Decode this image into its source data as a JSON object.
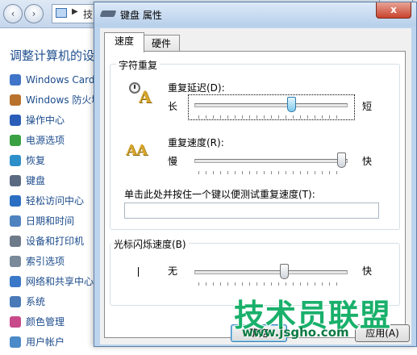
{
  "background": {
    "address_text": "技",
    "heading": "调整计算机的设",
    "items": [
      {
        "label": "Windows Card",
        "icon": "cardspace-icon",
        "color": "#3f74c9"
      },
      {
        "label": "Windows 防火墙",
        "icon": "firewall-icon",
        "color": "#b8722c"
      },
      {
        "label": "操作中心",
        "icon": "flag-icon",
        "color": "#2a5db8"
      },
      {
        "label": "电源选项",
        "icon": "power-icon",
        "color": "#3aa043"
      },
      {
        "label": "恢复",
        "icon": "recovery-icon",
        "color": "#2c8fc9"
      },
      {
        "label": "键盘",
        "icon": "keyboard-icon",
        "color": "#5a6a80"
      },
      {
        "label": "轻松访问中心",
        "icon": "ease-of-access-icon",
        "color": "#2b6fc2"
      },
      {
        "label": "日期和时间",
        "icon": "calendar-icon",
        "color": "#4f83c0"
      },
      {
        "label": "设备和打印机",
        "icon": "printer-icon",
        "color": "#6d7a8a"
      },
      {
        "label": "索引选项",
        "icon": "index-icon",
        "color": "#7a8a9a"
      },
      {
        "label": "网络和共享中心",
        "icon": "network-icon",
        "color": "#3a78c8"
      },
      {
        "label": "系统",
        "icon": "computer-icon",
        "color": "#4a7bb8"
      },
      {
        "label": "颜色管理",
        "icon": "color-management-icon",
        "color": "#c84a8a"
      },
      {
        "label": "用户帐户",
        "icon": "users-icon",
        "color": "#4a8ac8"
      }
    ]
  },
  "dialog": {
    "title": "键盘 属性",
    "close_label": "x",
    "tabs": [
      {
        "label": "速度",
        "active": true
      },
      {
        "label": "硬件",
        "active": false
      }
    ],
    "char_repeat": {
      "group_label": "字符重复",
      "delay": {
        "label": "重复延迟(D):",
        "min_label": "长",
        "max_label": "短",
        "value_fraction": 0.65,
        "icon": "repeat-delay-icon"
      },
      "rate": {
        "label": "重复速度(R):",
        "min_label": "慢",
        "max_label": "快",
        "value_fraction": 1.0,
        "icon": "repeat-rate-icon"
      },
      "test_label": "单击此处并按住一个键以便测试重复速度(T):",
      "test_value": ""
    },
    "cursor_blink": {
      "group_label": "光标闪烁速度(B)",
      "min_label": "无",
      "max_label": "快",
      "value_fraction": 0.6,
      "icon": "cursor-icon"
    },
    "buttons": {
      "ok": "确定",
      "apply": "应用(A)"
    }
  },
  "watermark": {
    "text": "技术员联盟",
    "url": "www.jsgho.com"
  }
}
